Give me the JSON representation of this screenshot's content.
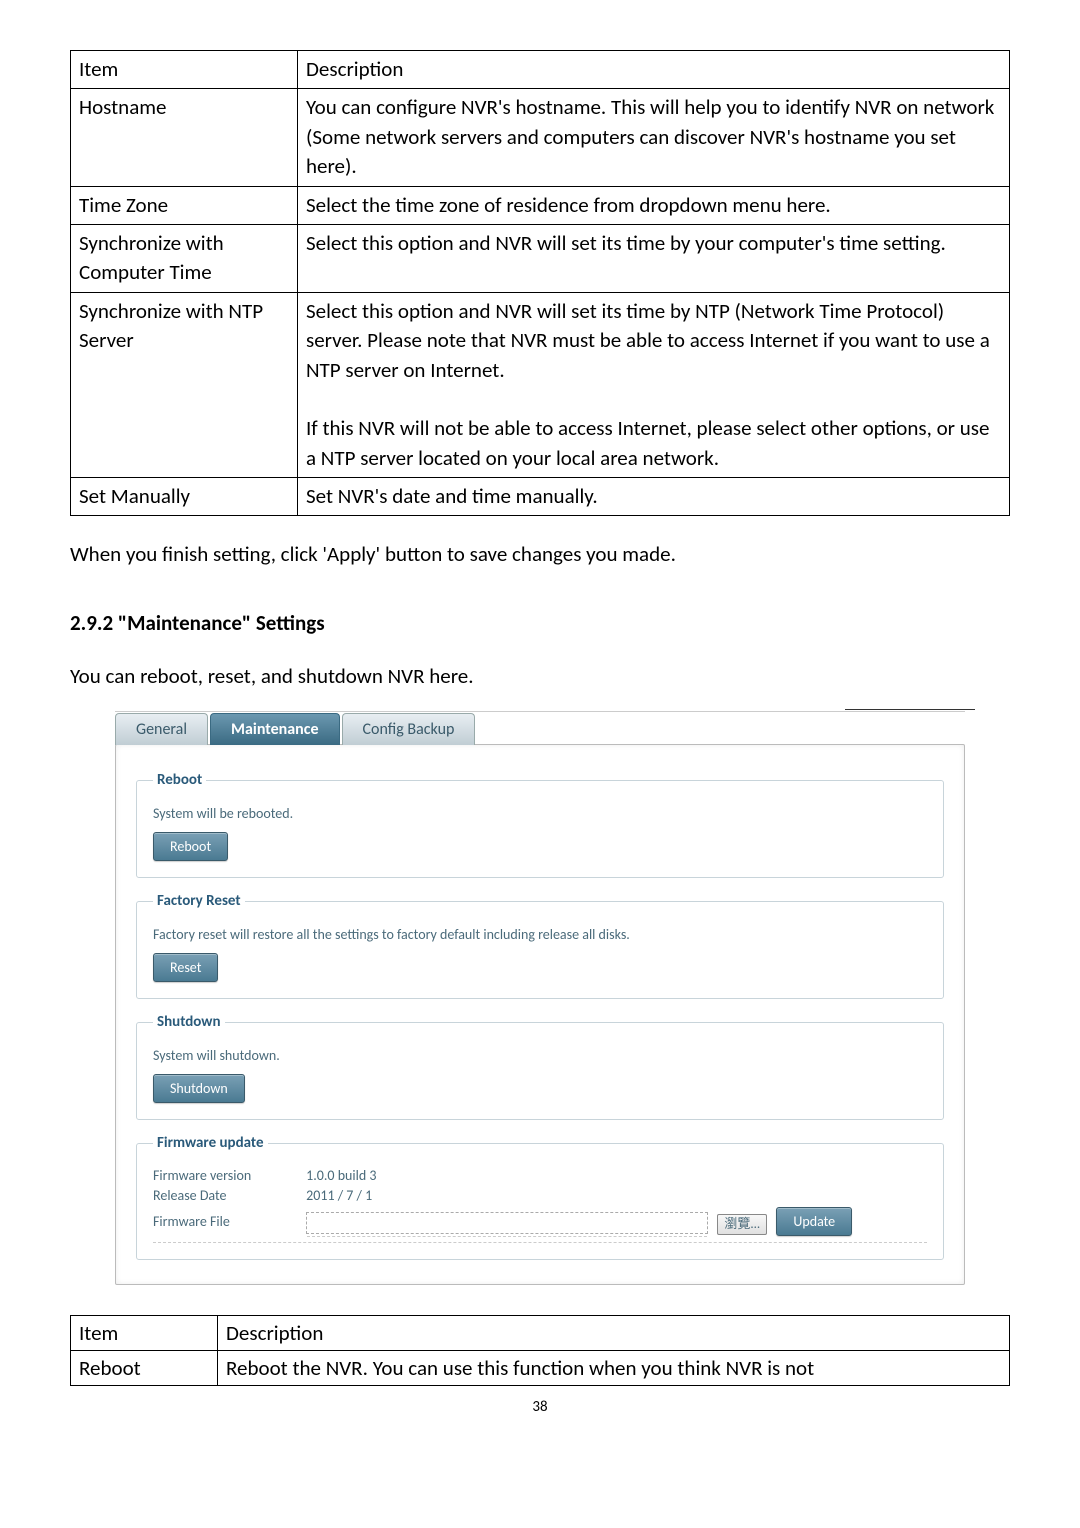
{
  "table1": {
    "header": {
      "c1": "Item",
      "c2": "Description"
    },
    "rows": [
      {
        "c1": "Hostname",
        "c2": "You can configure NVR's hostname. This will help you to identify NVR on network (Some network servers and computers can discover NVR's hostname you set here)."
      },
      {
        "c1": "Time Zone",
        "c2": "Select the time zone of residence from dropdown menu here."
      },
      {
        "c1": "Synchronize with Computer Time",
        "c2": "Select this option and NVR will set its time by your computer's time setting."
      },
      {
        "c1": "Synchronize with NTP Server",
        "c2": "Select this option and NVR will set its time by NTP (Network Time Protocol) server. Please note that NVR must be able to access Internet if you want to use a NTP server on Internet.\n\nIf this NVR will not be able to access Internet, please select other options, or use a NTP server located on your local area network."
      },
      {
        "c1": "Set Manually",
        "c2": "Set NVR's date and time manually."
      }
    ]
  },
  "para_after_table1": "When you finish setting, click 'Apply' button to save changes you made.",
  "heading": "2.9.2 \"Maintenance\" Settings",
  "para_after_heading": "You can reboot, reset, and shutdown NVR here.",
  "screenshot": {
    "tabs": {
      "general": "General",
      "maintenance": "Maintenance",
      "config": "Config Backup"
    },
    "reboot": {
      "legend": "Reboot",
      "text": "System will be rebooted.",
      "button": "Reboot"
    },
    "factory": {
      "legend": "Factory Reset",
      "text": "Factory reset will restore all the settings to factory default including release all disks.",
      "button": "Reset"
    },
    "shutdown": {
      "legend": "Shutdown",
      "text": "System will shutdown.",
      "button": "Shutdown"
    },
    "firmware": {
      "legend": "Firmware update",
      "version_label": "Firmware version",
      "version_value": "1.0.0 build 3",
      "date_label": "Release Date",
      "date_value": "2011 / 7 / 1",
      "file_label": "Firmware File",
      "browse": "瀏覽...",
      "update": "Update"
    }
  },
  "table2": {
    "header": {
      "c1": "Item",
      "c2": "Description"
    },
    "rows": [
      {
        "c1": "Reboot",
        "c2": "Reboot the NVR. You can use this function when you think NVR is not"
      }
    ]
  },
  "page_number": "38"
}
